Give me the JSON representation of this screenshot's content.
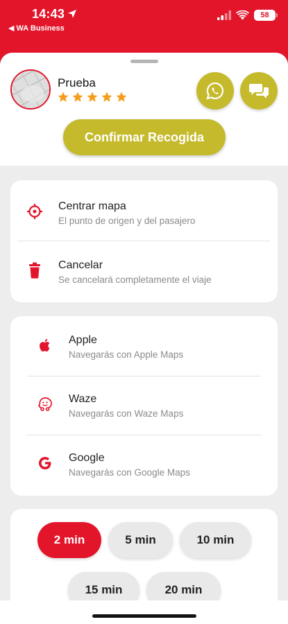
{
  "status_bar": {
    "time": "14:43",
    "back_label": "◀ WA Business",
    "battery": "58"
  },
  "driver": {
    "name": "Prueba",
    "rating": 5
  },
  "actions": {
    "whatsapp_icon": "whatsapp-icon",
    "chat_icon": "chat-bubbles-icon",
    "confirm_label": "Confirmar Recogida"
  },
  "map_options": [
    {
      "title": "Centrar mapa",
      "subtitle": "El punto de origen y del pasajero",
      "icon": "crosshair-icon"
    },
    {
      "title": "Cancelar",
      "subtitle": "Se cancelará completamente el viaje",
      "icon": "trash-icon"
    }
  ],
  "navigation_apps": [
    {
      "title": "Apple",
      "subtitle": "Navegarás con Apple Maps",
      "icon": "apple-icon"
    },
    {
      "title": "Waze",
      "subtitle": "Navegarás con Waze Maps",
      "icon": "waze-icon"
    },
    {
      "title": "Google",
      "subtitle": "Navegarás con Google Maps",
      "icon": "google-icon"
    }
  ],
  "wait_times": {
    "selected": "2 min",
    "options": [
      "2 min",
      "5 min",
      "10 min",
      "15 min",
      "20 min"
    ]
  },
  "colors": {
    "primary_red": "#e2152b",
    "accent_olive": "#c5ba2c"
  }
}
